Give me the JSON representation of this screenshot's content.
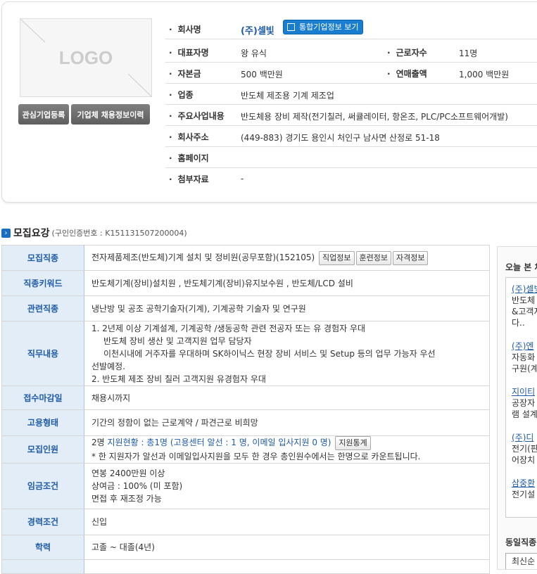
{
  "company": {
    "logo_text": "LOGO",
    "buttons": {
      "interest": "관심기업등록",
      "history": "기업체 채용정보이력"
    },
    "name_label": "회사명",
    "name": "(주)셀빛",
    "info_button": "통합기업정보 보기",
    "rows": [
      {
        "label": "대표자명",
        "value": "왕 유식",
        "label2": "근로자수",
        "value2": "11명"
      },
      {
        "label": "자본금",
        "value": "500 백만원",
        "label2": "연매출액",
        "value2": "1,000 백만원"
      },
      {
        "label": "업종",
        "value": "반도체 제조용 기계 제조업"
      },
      {
        "label": "주요사업내용",
        "value": "반도체용 장비 제작(전기칠러, 써큘레이터, 항온조, PLC/PC소프트웨어개발)"
      },
      {
        "label": "회사주소",
        "value": "(449-883) 경기도 용인시 처인구 남사면 산정로 51-18"
      },
      {
        "label": "홈페이지",
        "value": ""
      },
      {
        "label": "첨부자료",
        "value": "-"
      }
    ]
  },
  "recruit": {
    "title": "모집요강",
    "cert": "(구인인증번호 : K151131507200004)",
    "job_label": "모집직종",
    "job": "전자제품제조(반도체)기계 설치 및 정비원(공무포함)(152105)",
    "job_buttons": [
      "직업정보",
      "훈련정보",
      "자격정보"
    ],
    "keyword_label": "직종키워드",
    "keyword": "반도체기계(장비)설치원 , 반도체기계(장비)유지보수원 , 반도체/LCD 설비",
    "related_label": "관련직종",
    "related": "냉난방 및 공조 공학기술자(기계), 기계공학 기술자 및 연구원",
    "duty_label": "직무내용",
    "duty": [
      "1. 2년제 이상 기계설계, 기계공학 /생동공학 관련 전공자 또는 유 경험자 우대",
      "반도체 장비 생산 및 고객지원 업무 담당자",
      "이천시내에 거주자를 우대하며 SK하이닉스 현장 장비 서비스 및 Setup 등의 업무 가능자 우선",
      "선발예정.",
      "2. 반도체 제조 장비 칠러 고객지원 유경험자 우대"
    ],
    "deadline_label": "접수마감일",
    "deadline": "채용시까지",
    "type_label": "고용형태",
    "type": "기간의 정함이 없는 근로계약 / 파견근로 비희망",
    "count_label": "모집인원",
    "count": "2명",
    "count_status": "지원현황 : 총1명 (고용센터 알선 : 1 명, 이메일 입사지원 0 명)",
    "count_button": "지원통계",
    "count_note": "* 한 지원자가 알선과 이메일입사지원을 모두 한 경우 총인원수에서는 한명으로 카운트됩니다.",
    "wage_label": "임금조건",
    "wage": [
      "연봉 2400만원 이상",
      "상여금 : 100% (미 포함)",
      "면접 후 재조정 가능"
    ],
    "career_label": "경력조건",
    "career": "신입",
    "edu_label": "학력",
    "edu": "고졸 ~ 대졸(4년)"
  },
  "sidebar": {
    "title": "오늘 본 채",
    "items": [
      {
        "name": "(주)셀빛",
        "desc": [
          "반도체",
          "&고객지",
          "다.."
        ]
      },
      {
        "name": "(주)엔",
        "desc": [
          "자동화",
          "구원(계"
        ]
      },
      {
        "name": "지이티",
        "desc": [
          "공장자",
          "램 설계"
        ]
      },
      {
        "name": "(주)디",
        "desc": [
          "전기(판",
          "어장치"
        ]
      },
      {
        "name": "삼중환",
        "desc": [
          "전기설"
        ]
      }
    ],
    "title2": "동일직종",
    "sort": "최신순"
  }
}
